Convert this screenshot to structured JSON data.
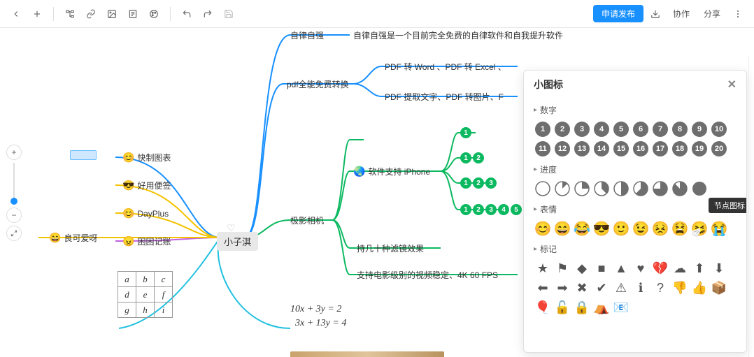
{
  "toolbar": {
    "publish": "申请发布",
    "collab": "协作",
    "share": "分享"
  },
  "mindmap": {
    "root": "小子淇",
    "left": {
      "n1": "快制图表",
      "n2": "好用便签",
      "n3": "DayPlus",
      "n4": "困困记账",
      "n5": "良可爱呀"
    },
    "right": {
      "a_title": "自律自强",
      "a_desc": "自律自强是一个目前完全免费的自律软件和自我提升软件",
      "b_title": "pdf全能免费转换",
      "b_c1": "PDF 转 Word 、PDF 转 Excel 、",
      "b_c2": "PDF 提取文字、PDF 转图片、F",
      "c_title": "极影相机",
      "c_c1": "软件支持 iPhone",
      "c_c2": "持几十种滤镜效果",
      "c_c3": "支持电影级别的视频稳定、4K 60 FPS"
    }
  },
  "table": {
    "r1": [
      "a",
      "b",
      "c"
    ],
    "r2": [
      "d",
      "e",
      "f"
    ],
    "r3": [
      "g",
      "h",
      "i"
    ]
  },
  "equations": {
    "e1": "10x + 3y = 2",
    "e2": "3x + 13y = 4"
  },
  "panel": {
    "title": "小图标",
    "tooltip": "节点图标",
    "sections": {
      "numbers": "数字",
      "progress": "进度",
      "emoji": "表情",
      "marks": "标记"
    },
    "numbers": [
      "1",
      "2",
      "3",
      "4",
      "5",
      "6",
      "7",
      "8",
      "9",
      "10",
      "11",
      "12",
      "13",
      "14",
      "15",
      "16",
      "17",
      "18",
      "19",
      "20"
    ],
    "progress_pct": [
      0,
      12.5,
      25,
      37.5,
      50,
      62.5,
      75,
      87.5,
      100
    ],
    "emojis": [
      "😊",
      "😄",
      "😂",
      "😎",
      "🙂",
      "😉",
      "😣",
      "😫",
      "🤧",
      "😭"
    ],
    "marks_row1": [
      "★",
      "⚑",
      "◆",
      "■",
      "▲",
      "♥",
      "💔",
      "☁",
      "⬆",
      "⬇"
    ],
    "marks_row2": [
      "⬅",
      "➡",
      "✖",
      "✔",
      "⚠",
      "ℹ",
      "?",
      "👎",
      "👍",
      "📦"
    ],
    "marks_row3": [
      "🎈",
      "🔓",
      "🔒",
      "⛺",
      "📧"
    ]
  }
}
